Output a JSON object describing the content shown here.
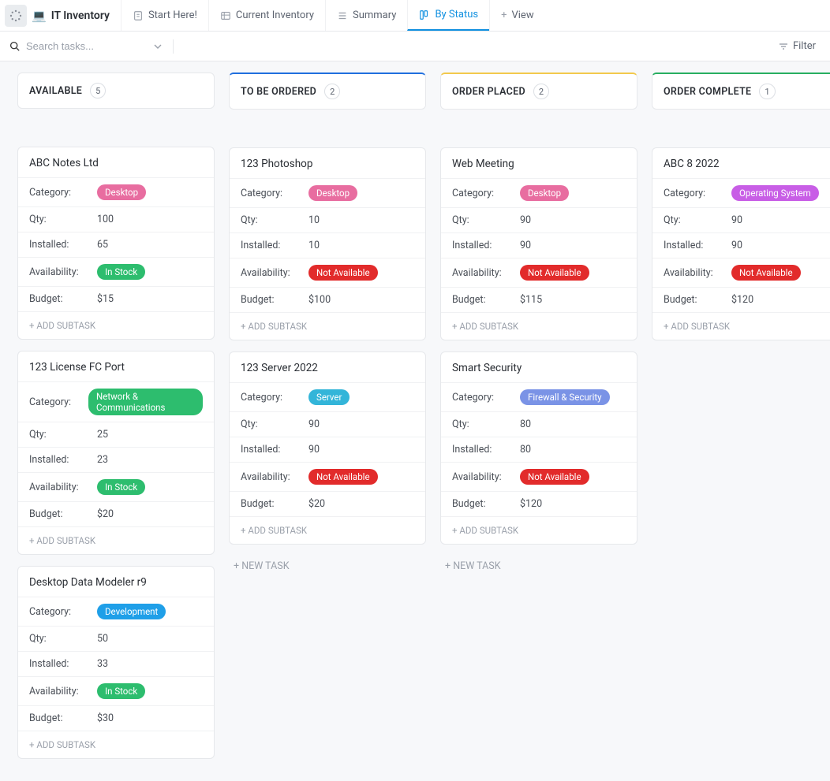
{
  "app": {
    "title": "IT Inventory",
    "emoji": "💻"
  },
  "tabs": [
    {
      "label": "Start Here!",
      "active": false
    },
    {
      "label": "Current Inventory",
      "active": false
    },
    {
      "label": "Summary",
      "active": false
    },
    {
      "label": "By Status",
      "active": true
    }
  ],
  "view_add_label": "View",
  "search": {
    "placeholder": "Search tasks..."
  },
  "filter_label": "Filter",
  "labels": {
    "category": "Category:",
    "qty": "Qty:",
    "installed": "Installed:",
    "availability": "Availability:",
    "budget": "Budget:",
    "add_subtask": "+ ADD SUBTASK",
    "new_task": "+ NEW TASK"
  },
  "columns": [
    {
      "title": "AVAILABLE",
      "count": "5",
      "color": "",
      "show_new_task": false,
      "cards": [
        {
          "title": "ABC Notes Ltd",
          "category": "Desktop",
          "cat_class": "desktop",
          "qty": "100",
          "installed": "65",
          "availability": "In Stock",
          "avail_class": "instock",
          "budget": "$15"
        },
        {
          "title": "123 License FC Port",
          "category": "Network & Communications",
          "cat_class": "netcom",
          "qty": "25",
          "installed": "23",
          "availability": "In Stock",
          "avail_class": "instock",
          "budget": "$20"
        },
        {
          "title": "Desktop Data Modeler r9",
          "category": "Development",
          "cat_class": "dev",
          "qty": "50",
          "installed": "33",
          "availability": "In Stock",
          "avail_class": "instock",
          "budget": "$30"
        }
      ]
    },
    {
      "title": "TO BE ORDERED",
      "count": "2",
      "color": "top-blue",
      "show_new_task": true,
      "cards": [
        {
          "title": "123 Photoshop",
          "category": "Desktop",
          "cat_class": "desktop",
          "qty": "10",
          "installed": "10",
          "availability": "Not Available",
          "avail_class": "notavail",
          "budget": "$100"
        },
        {
          "title": "123 Server 2022",
          "category": "Server",
          "cat_class": "server",
          "qty": "90",
          "installed": "90",
          "availability": "Not Available",
          "avail_class": "notavail",
          "budget": "$20"
        }
      ]
    },
    {
      "title": "ORDER PLACED",
      "count": "2",
      "color": "top-yellow",
      "show_new_task": true,
      "cards": [
        {
          "title": "Web Meeting",
          "category": "Desktop",
          "cat_class": "desktop",
          "qty": "90",
          "installed": "90",
          "availability": "Not Available",
          "avail_class": "notavail",
          "budget": "$115"
        },
        {
          "title": "Smart Security",
          "category": "Firewall & Security",
          "cat_class": "firewall",
          "qty": "80",
          "installed": "80",
          "availability": "Not Available",
          "avail_class": "notavail",
          "budget": "$120"
        }
      ]
    },
    {
      "title": "ORDER COMPLETE",
      "count": "1",
      "color": "top-green",
      "show_new_task": false,
      "cards": [
        {
          "title": "ABC 8 2022",
          "category": "Operating System",
          "cat_class": "os",
          "qty": "90",
          "installed": "90",
          "availability": "Not Available",
          "avail_class": "notavail",
          "budget": "$120"
        }
      ]
    }
  ]
}
